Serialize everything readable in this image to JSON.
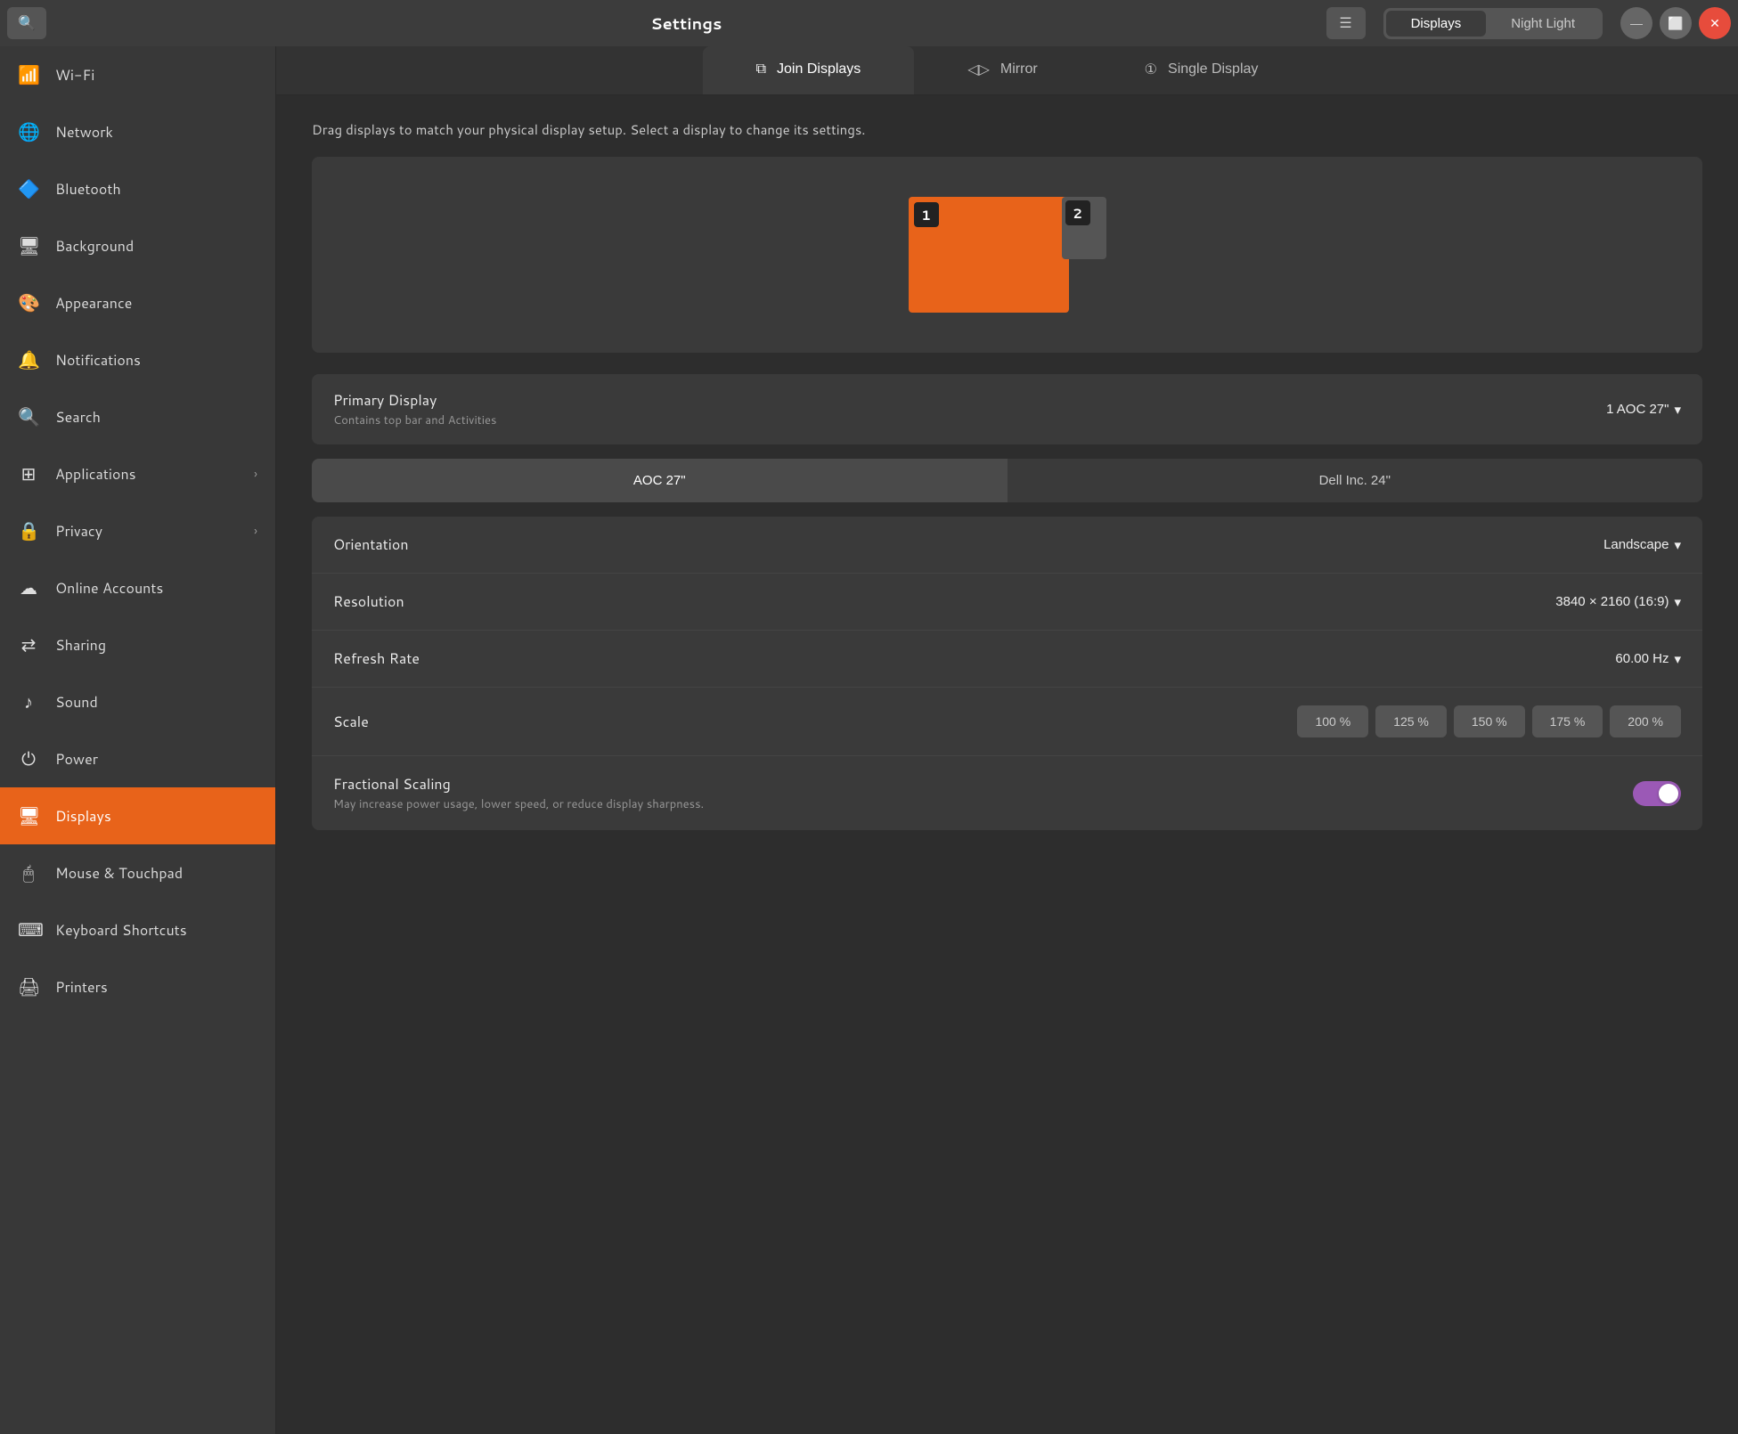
{
  "titlebar": {
    "title": "Settings",
    "tabs": [
      {
        "label": "Displays",
        "active": true
      },
      {
        "label": "Night Light",
        "active": false
      }
    ],
    "controls": {
      "minimize": "—",
      "maximize": "⬜",
      "close": "✕"
    }
  },
  "sidebar": {
    "items": [
      {
        "id": "wifi",
        "label": "Wi-Fi",
        "icon": "📶",
        "hasChevron": false,
        "active": false
      },
      {
        "id": "network",
        "label": "Network",
        "icon": "🌐",
        "hasChevron": false,
        "active": false
      },
      {
        "id": "bluetooth",
        "label": "Bluetooth",
        "icon": "🔷",
        "hasChevron": false,
        "active": false
      },
      {
        "id": "background",
        "label": "Background",
        "icon": "🖥",
        "hasChevron": false,
        "active": false
      },
      {
        "id": "appearance",
        "label": "Appearance",
        "icon": "🎨",
        "hasChevron": false,
        "active": false
      },
      {
        "id": "notifications",
        "label": "Notifications",
        "icon": "🔔",
        "hasChevron": false,
        "active": false
      },
      {
        "id": "search",
        "label": "Search",
        "icon": "🔍",
        "hasChevron": false,
        "active": false
      },
      {
        "id": "applications",
        "label": "Applications",
        "icon": "⊞",
        "hasChevron": true,
        "active": false
      },
      {
        "id": "privacy",
        "label": "Privacy",
        "icon": "🔒",
        "hasChevron": true,
        "active": false
      },
      {
        "id": "online-accounts",
        "label": "Online Accounts",
        "icon": "☁",
        "hasChevron": false,
        "active": false
      },
      {
        "id": "sharing",
        "label": "Sharing",
        "icon": "⇄",
        "hasChevron": false,
        "active": false
      },
      {
        "id": "sound",
        "label": "Sound",
        "icon": "♪",
        "hasChevron": false,
        "active": false
      },
      {
        "id": "power",
        "label": "Power",
        "icon": "⏻",
        "hasChevron": false,
        "active": false
      },
      {
        "id": "displays",
        "label": "Displays",
        "icon": "🖥",
        "hasChevron": false,
        "active": true
      },
      {
        "id": "mouse-touchpad",
        "label": "Mouse & Touchpad",
        "icon": "🖱",
        "hasChevron": false,
        "active": false
      },
      {
        "id": "keyboard-shortcuts",
        "label": "Keyboard Shortcuts",
        "icon": "⌨",
        "hasChevron": false,
        "active": false
      },
      {
        "id": "printers",
        "label": "Printers",
        "icon": "🖨",
        "hasChevron": false,
        "active": false
      }
    ]
  },
  "content": {
    "display_tabs": [
      {
        "label": "Join Displays",
        "icon": "⧉",
        "active": true
      },
      {
        "label": "Mirror",
        "icon": "◁▷",
        "active": false
      },
      {
        "label": "Single Display",
        "icon": "①",
        "active": false
      }
    ],
    "hint": "Drag displays to match your physical display setup. Select a display to change its settings.",
    "display_1_badge": "1",
    "display_2_badge": "2",
    "primary_display": {
      "main_label": "Primary Display",
      "sub_label": "Contains top bar and Activities",
      "value": "1  AOC 27\""
    },
    "monitor_tabs": [
      {
        "label": "AOC 27\"",
        "active": true
      },
      {
        "label": "Dell Inc. 24\"",
        "active": false
      }
    ],
    "settings": [
      {
        "label": "Orientation",
        "value": "Landscape",
        "type": "dropdown"
      },
      {
        "label": "Resolution",
        "value": "3840 × 2160 (16:9)",
        "type": "dropdown"
      },
      {
        "label": "Refresh Rate",
        "value": "60.00 Hz",
        "type": "dropdown"
      },
      {
        "label": "Scale",
        "value": "",
        "type": "scale"
      },
      {
        "label": "Fractional Scaling",
        "sub_label": "May increase power usage, lower speed, or reduce display sharpness.",
        "value": "on",
        "type": "toggle"
      }
    ],
    "scale_options": [
      "100 %",
      "125 %",
      "150 %",
      "175 %",
      "200 %"
    ]
  }
}
